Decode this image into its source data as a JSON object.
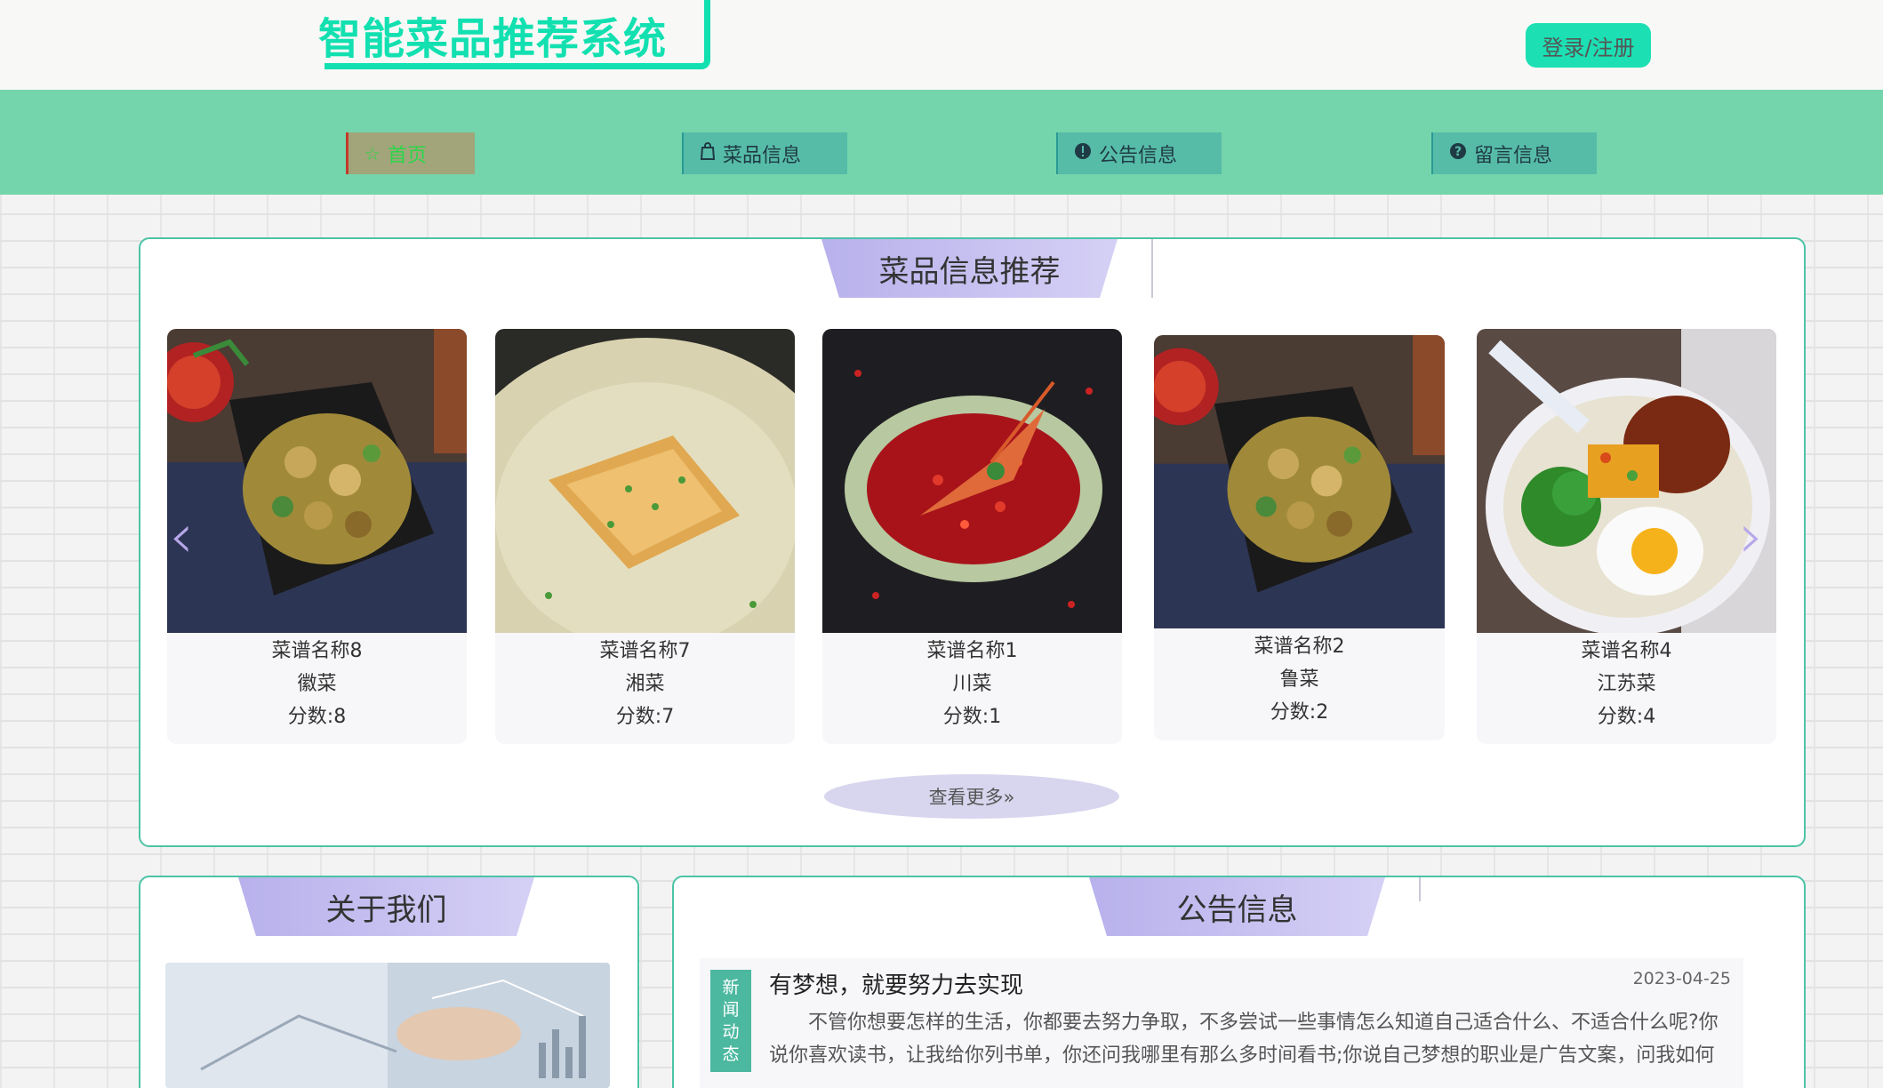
{
  "header": {
    "logo_text": "智能菜品推荐系统",
    "login_button": "登录/注册"
  },
  "nav": {
    "items": [
      {
        "label": "首页",
        "icon": "star-icon"
      },
      {
        "label": "菜品信息",
        "icon": "bag-icon"
      },
      {
        "label": "公告信息",
        "icon": "alert-icon"
      },
      {
        "label": "留言信息",
        "icon": "help-icon"
      }
    ],
    "active_index": 0
  },
  "recommend": {
    "title": "菜品信息推荐",
    "cards": [
      {
        "name": "菜谱名称8",
        "cuisine": "徽菜",
        "score": "分数:8"
      },
      {
        "name": "菜谱名称7",
        "cuisine": "湘菜",
        "score": "分数:7"
      },
      {
        "name": "菜谱名称1",
        "cuisine": "川菜",
        "score": "分数:1"
      },
      {
        "name": "菜谱名称2",
        "cuisine": "鲁菜",
        "score": "分数:2"
      },
      {
        "name": "菜谱名称4",
        "cuisine": "江苏菜",
        "score": "分数:4"
      }
    ],
    "more_button": "查看更多»"
  },
  "about": {
    "title": "关于我们"
  },
  "notice": {
    "title": "公告信息",
    "items": [
      {
        "tag": [
          "新",
          "闻",
          "动",
          "态"
        ],
        "title": "有梦想，就要努力去实现",
        "date": "2023-04-25",
        "body": "不管你想要怎样的生活，你都要去努力争取，不多尝试一些事情怎么知道自己适合什么、不适合什么呢?你说你喜欢读书，让我给你列书单，你还问我哪里有那么多时间看书;你说自己梦想的职业是广告文案，问我如何成为一"
      }
    ]
  },
  "colors": {
    "brand": "#12e0b0",
    "nav_bg": "#74d4ab",
    "panel_border": "#4cc3a6",
    "title_bg": "#b8b1ec"
  }
}
